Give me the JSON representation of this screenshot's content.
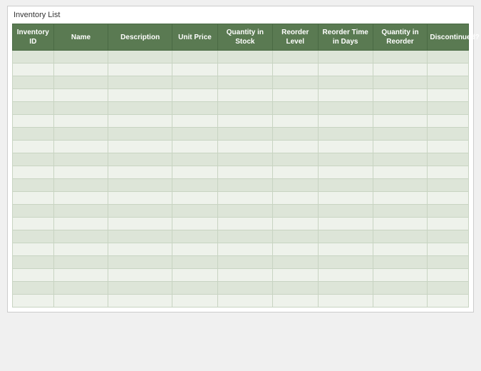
{
  "title": "Inventory List",
  "columns": [
    {
      "key": "inventory_id",
      "label": "Inventory ID"
    },
    {
      "key": "name",
      "label": "Name"
    },
    {
      "key": "description",
      "label": "Description"
    },
    {
      "key": "unit_price",
      "label": "Unit Price"
    },
    {
      "key": "quantity_in_stock",
      "label": "Quantity in Stock"
    },
    {
      "key": "reorder_level",
      "label": "Reorder Level"
    },
    {
      "key": "reorder_time_in_days",
      "label": "Reorder Time in Days"
    },
    {
      "key": "quantity_in_reorder",
      "label": "Quantity in Reorder"
    },
    {
      "key": "discontinued",
      "label": "Discontinued?"
    }
  ],
  "rows": 20
}
